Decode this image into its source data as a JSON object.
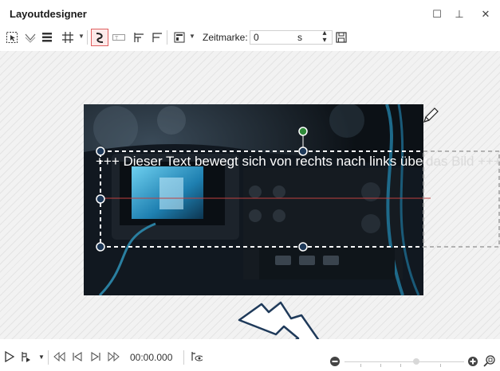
{
  "window": {
    "title": "Layoutdesigner",
    "controls": [
      "minimize-icon",
      "pin-icon",
      "close-icon"
    ],
    "minimize_glyph": "☐",
    "pin_glyph": "⊥",
    "close_glyph": "✕"
  },
  "toolbar": {
    "zeitmarke_label": "Zeitmarke:",
    "zeitmarke_value": "0",
    "zeitmarke_unit": "s",
    "spin_up": "▴",
    "spin_down": "▾",
    "caret": "▼",
    "icons": [
      "select-object-icon",
      "guides-icon",
      "lines-icon",
      "grid-icon",
      "motion-path-icon",
      "text-frame-icon",
      "align-left-icon",
      "align-right-icon",
      "layout-template-icon",
      "save-icon"
    ]
  },
  "layer": {
    "text": "+++ Dieser Text bewegt sich von rechts nach links über",
    "text_overflow": "das Bild +++"
  },
  "bottombar": {
    "timecode": "00:00.000",
    "caret": "▼",
    "icons": [
      "play-icon",
      "add-keyframe-icon",
      "previous-keyframe-icon",
      "step-back-icon",
      "step-forward-icon",
      "next-keyframe-icon",
      "visibility-icon",
      "zoom-out-icon",
      "zoom-in-icon",
      "zoom-fit-icon"
    ]
  },
  "colors": {
    "accent_red": "#e06060",
    "handle_blue": "#1f3a5a",
    "handle_green": "#2f8a3a",
    "highlight_box": "#1f3a5a"
  }
}
